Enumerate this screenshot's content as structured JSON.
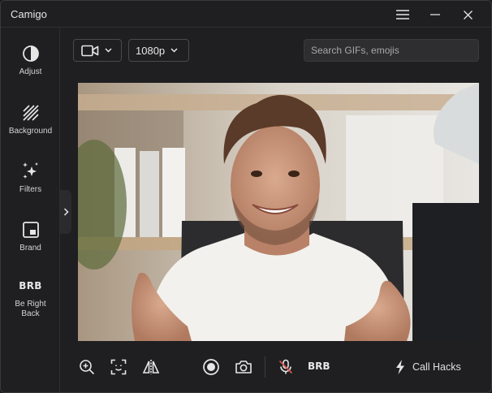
{
  "app": {
    "title": "Camigo"
  },
  "window_controls": [
    "menu-icon",
    "minimize-icon",
    "close-icon"
  ],
  "sidebar": {
    "items": [
      {
        "label": "Adjust",
        "icon": "contrast-icon"
      },
      {
        "label": "Background",
        "icon": "background-stripes-icon"
      },
      {
        "label": "Filters",
        "icon": "sparkles-icon"
      },
      {
        "label": "Brand",
        "icon": "brand-frame-icon"
      },
      {
        "label": "Be Right Back",
        "glyph": "BRB",
        "icon": "brb-icon"
      }
    ]
  },
  "toolbar_top": {
    "camera_icon": "video-camera-icon",
    "resolution": "1080p",
    "search_placeholder": "Search GIFs, emojis"
  },
  "bottom_toolbar": {
    "tools": [
      "zoom-in-icon",
      "face-focus-icon",
      "mirror-flip-icon",
      "record-icon",
      "snapshot-camera-icon",
      "mic-off-icon"
    ],
    "brb_label": "BRB",
    "call_hacks_label": "Call Hacks"
  },
  "colors": {
    "background": "#1f1f21",
    "border": "#3a3a3c",
    "text": "#e6e6e6",
    "mic_off": "#d9534f"
  }
}
